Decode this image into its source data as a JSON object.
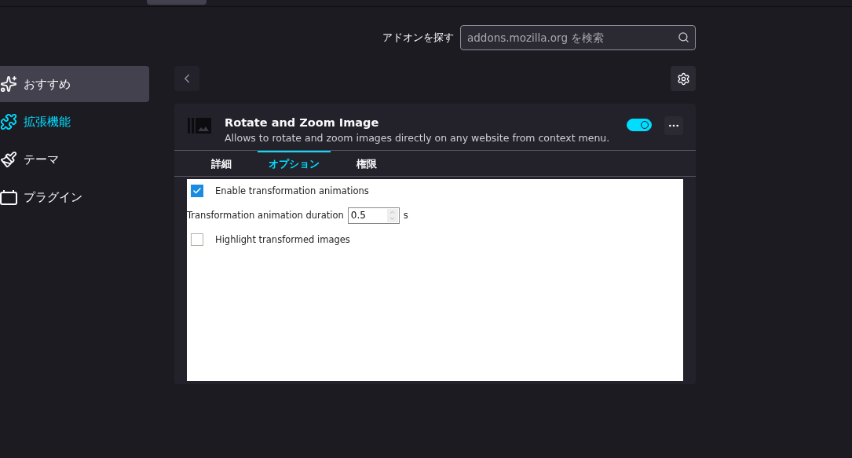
{
  "search": {
    "label": "アドオンを探す",
    "placeholder": "addons.mozilla.org を検索"
  },
  "sidebar": {
    "items": [
      {
        "label": "おすすめ",
        "selected": false,
        "hovered": true
      },
      {
        "label": "拡張機能",
        "selected": true,
        "hovered": false
      },
      {
        "label": "テーマ",
        "selected": false,
        "hovered": false
      },
      {
        "label": "プラグイン",
        "selected": false,
        "hovered": false
      }
    ]
  },
  "addon": {
    "name": "Rotate and Zoom Image",
    "description": "Allows to rotate and zoom images directly on any website from context menu.",
    "enabled": true,
    "tabs": [
      {
        "label": "詳細",
        "selected": false
      },
      {
        "label": "オプション",
        "selected": true
      },
      {
        "label": "権限",
        "selected": false
      }
    ],
    "options": [
      {
        "kind": "checkbox",
        "label": "Enable transformation animations",
        "checked": true
      },
      {
        "kind": "number",
        "label": "Transformation animation duration",
        "value": "0.5",
        "unit": "s"
      },
      {
        "kind": "checkbox",
        "label": "Highlight transformed images",
        "checked": false
      }
    ]
  }
}
